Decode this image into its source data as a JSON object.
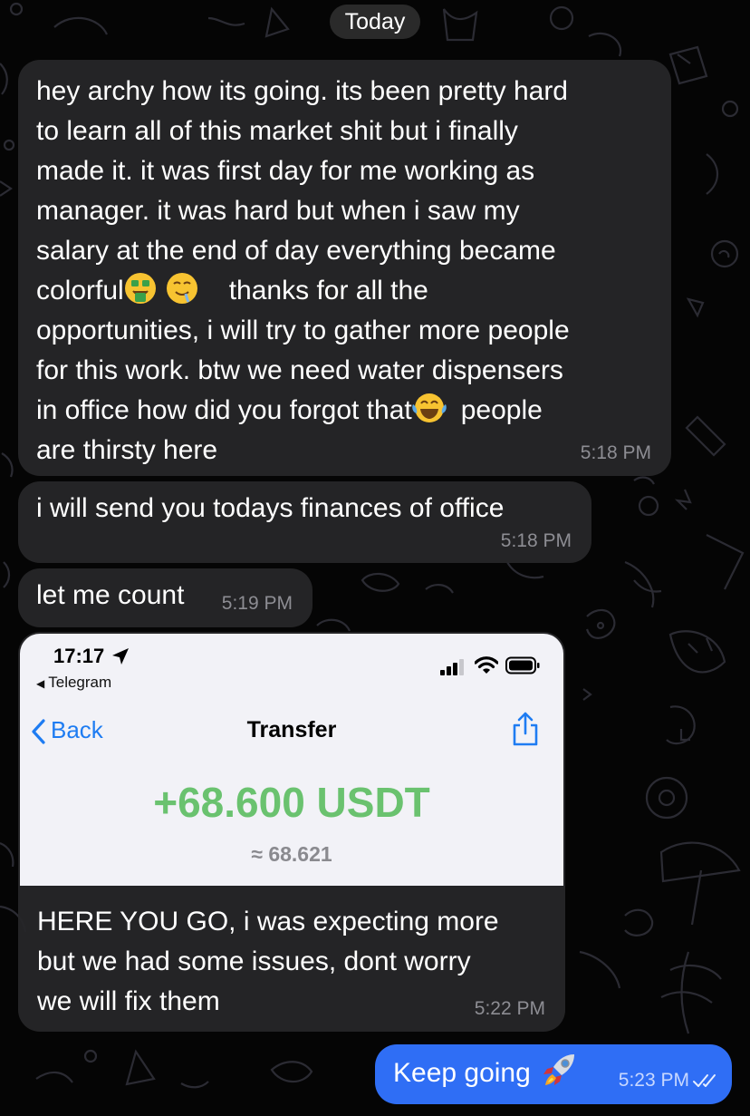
{
  "date_separator": "Today",
  "messages": [
    {
      "side": "incoming",
      "lines": [
        "hey archy how its going. its been pretty hard",
        "to learn all of this market shit but i finally",
        "made it. it was first day for me working as",
        "manager. it was hard but when i saw my",
        "salary at the end of day everything became",
        "colorful",
        "opportunities, i will try to gather more people",
        "for this work. btw we need water dispensers",
        "in office how did you forgot that",
        "are thirsty here"
      ],
      "line6_after_emoji": "thanks for all the",
      "line9_after_emoji": "people",
      "emojis": [
        "money-mouth-face",
        "drooling-face",
        "face-with-tears-of-joy"
      ],
      "time": "5:18 PM"
    },
    {
      "side": "incoming",
      "text": "i will send you todays finances of office",
      "time": "5:18 PM"
    },
    {
      "side": "incoming",
      "text": "let me count",
      "time": "5:19 PM"
    },
    {
      "side": "incoming",
      "screenshot": {
        "clock": "17:17",
        "back_app": "Telegram",
        "nav_back": "Back",
        "nav_title": "Transfer",
        "amount": "+68.600 USDT",
        "approx": "≈ 68.621",
        "amount_color": "#6ac26f",
        "accent_color": "#1e7cf2"
      },
      "caption_lines": [
        "HERE YOU GO, i was expecting more",
        "but we had some issues, dont worry",
        "we will fix them"
      ],
      "time": "5:22 PM"
    },
    {
      "side": "outgoing",
      "text": "Keep going",
      "emoji": "rocket",
      "time": "5:23 PM",
      "status": "read-double-check"
    }
  ],
  "colors": {
    "background": "#050505",
    "incoming_bubble": "#262628",
    "outgoing_bubble": "#2f6ef5",
    "timestamp": "#8d8d93"
  }
}
